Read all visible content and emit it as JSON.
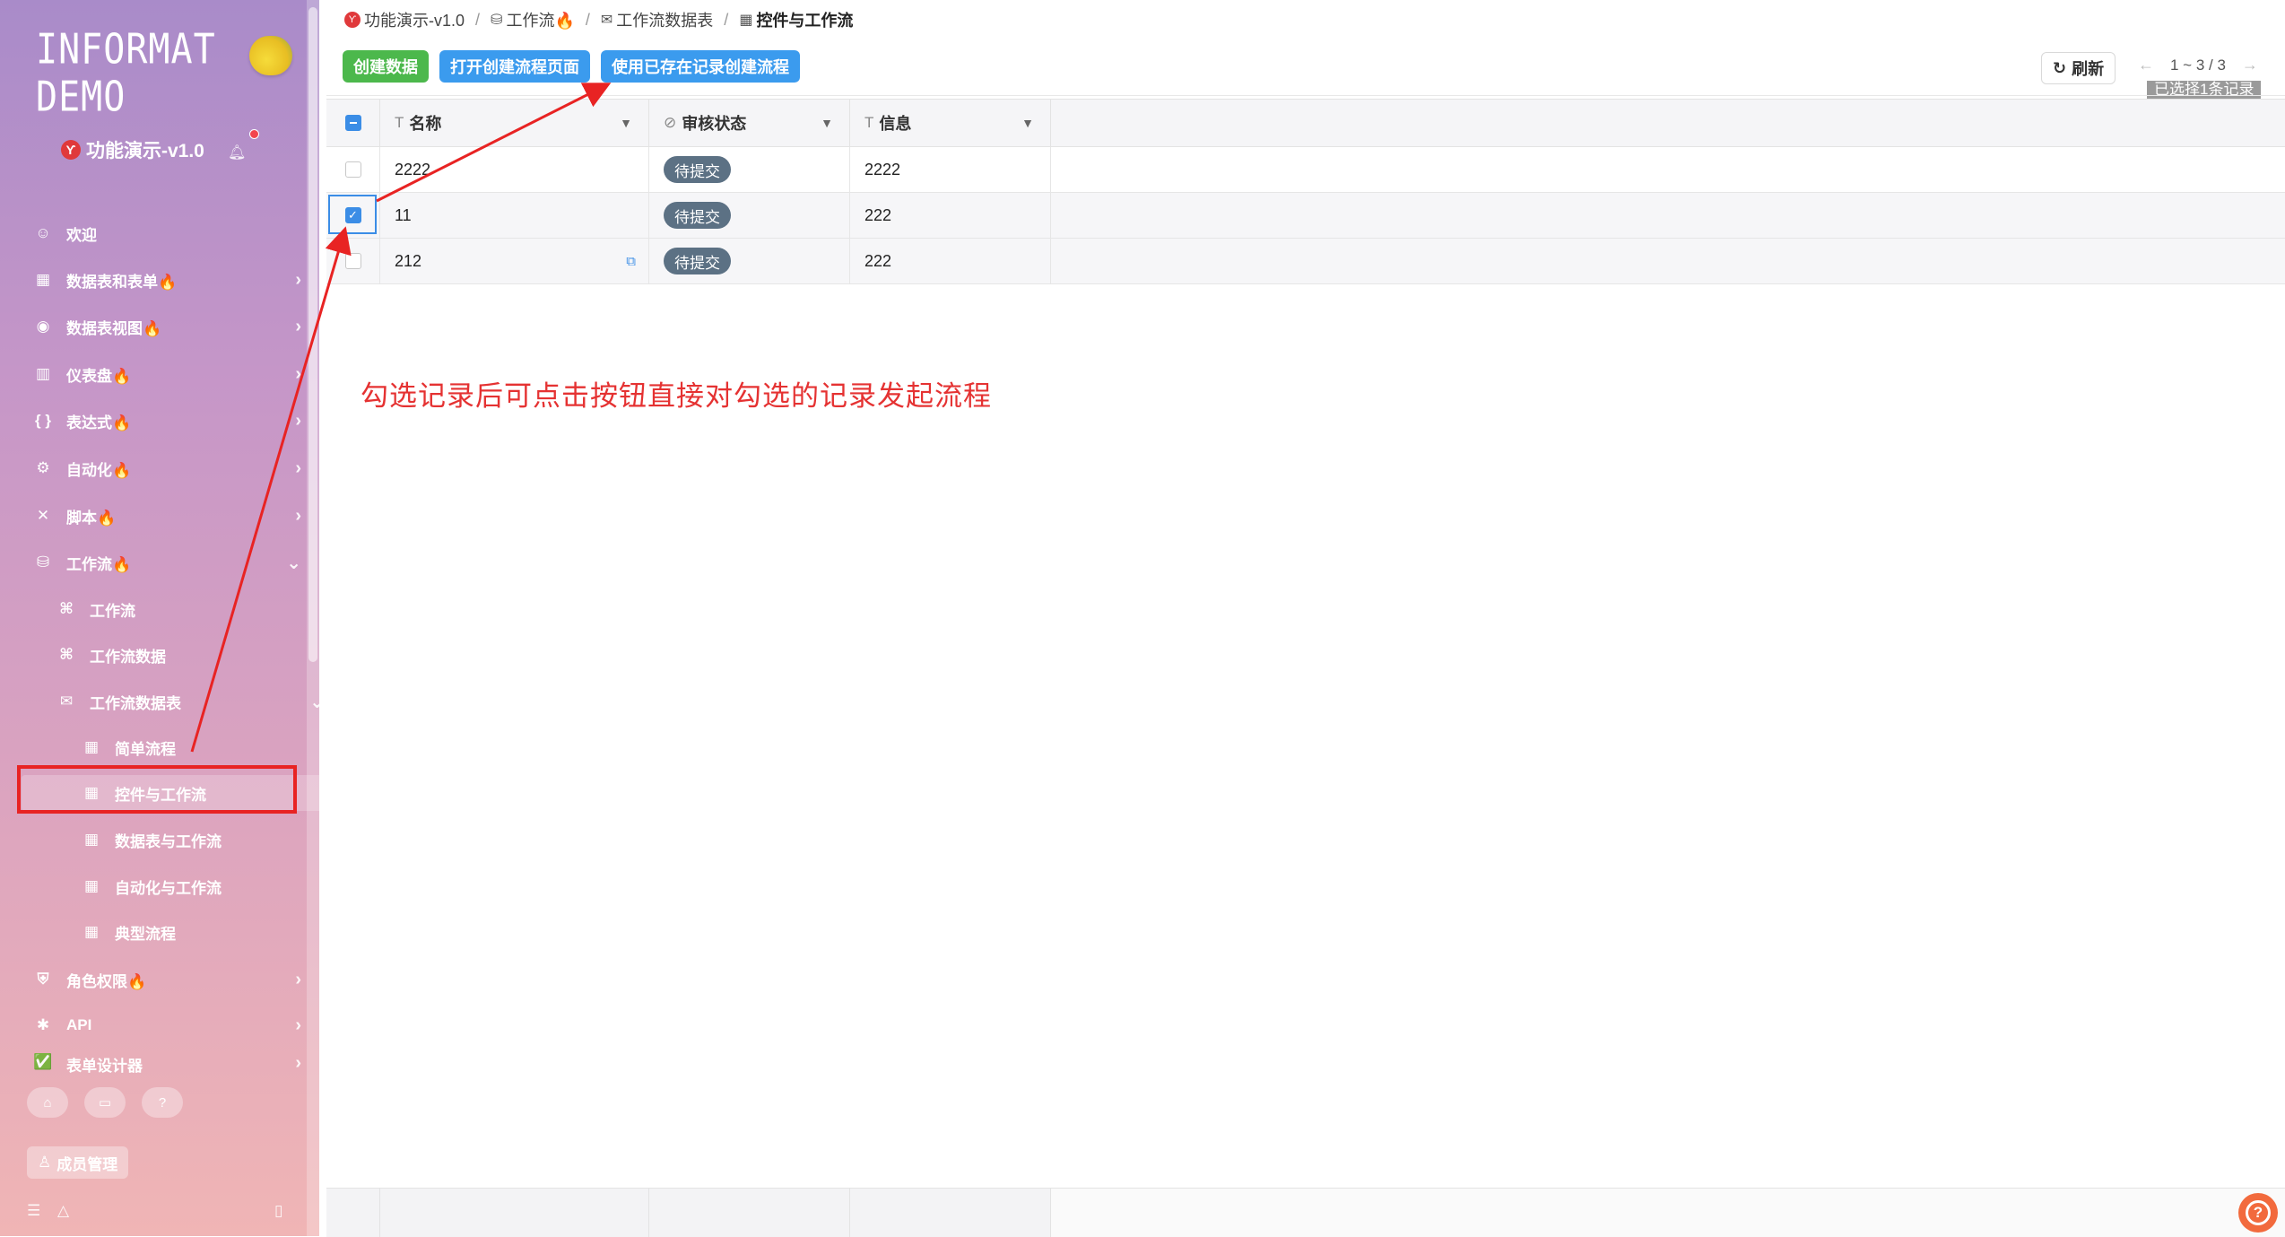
{
  "sidebar": {
    "brand": "INFORMAT DEMO",
    "app_title": "功能演示-v1.0",
    "items": [
      {
        "label": "欢迎",
        "icon": "smile-icon"
      },
      {
        "label": "数据表和表单🔥",
        "icon": "table-icon"
      },
      {
        "label": "数据表视图🔥",
        "icon": "view-icon"
      },
      {
        "label": "仪表盘🔥",
        "icon": "dashboard-icon"
      },
      {
        "label": "表达式🔥",
        "icon": "braces-icon"
      },
      {
        "label": "自动化🔥",
        "icon": "robot-icon"
      },
      {
        "label": "脚本🔥",
        "icon": "script-icon"
      },
      {
        "label": "工作流🔥",
        "icon": "workflow-icon"
      },
      {
        "label": "工作流",
        "icon": "flow-icon"
      },
      {
        "label": "工作流数据",
        "icon": "flow-icon"
      },
      {
        "label": "工作流数据表",
        "icon": "mail-icon"
      },
      {
        "label": "简单流程",
        "icon": "grid-icon"
      },
      {
        "label": "控件与工作流",
        "icon": "grid-icon"
      },
      {
        "label": "数据表与工作流",
        "icon": "grid-icon"
      },
      {
        "label": "自动化与工作流",
        "icon": "grid-icon"
      },
      {
        "label": "典型流程",
        "icon": "grid-icon"
      },
      {
        "label": "角色权限🔥",
        "icon": "shield-icon"
      },
      {
        "label": "API",
        "icon": "api-icon"
      },
      {
        "label": "表单设计器",
        "icon": "check-icon"
      }
    ],
    "member_button": "成员管理"
  },
  "breadcrumb": [
    "功能演示-v1.0",
    "工作流🔥",
    "工作流数据表",
    "控件与工作流"
  ],
  "toolbar": {
    "create": "创建数据",
    "open_flow_page": "打开创建流程页面",
    "create_from_record": "使用已存在记录创建流程",
    "refresh": "刷新",
    "pager": "1 ~ 3 / 3",
    "selected_note": "已选择1条记录"
  },
  "table": {
    "columns": [
      "名称",
      "审核状态",
      "信息"
    ],
    "rows": [
      {
        "name": "2222",
        "status": "待提交",
        "info": "2222",
        "checked": false
      },
      {
        "name": "11",
        "status": "待提交",
        "info": "222",
        "checked": true
      },
      {
        "name": "212",
        "status": "待提交",
        "info": "222",
        "checked": false
      }
    ]
  },
  "annotation": "勾选记录后可点击按钮直接对勾选的记录发起流程",
  "colors": {
    "accent_blue": "#3b9bee",
    "accent_green": "#4cb84c",
    "annotation_red": "#e53232",
    "status_tag": "#5c7184"
  }
}
